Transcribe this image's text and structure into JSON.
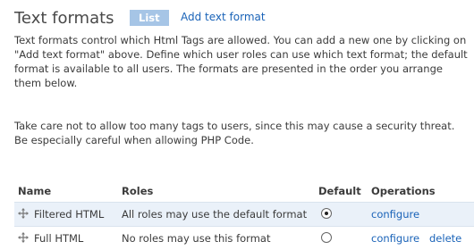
{
  "header": {
    "title": "Text formats",
    "tab_list": "List",
    "tab_add": "Add text format"
  },
  "description": {
    "p1": "Text formats control which Html Tags are allowed. You can add a new one by clicking on \"Add text format\" above. Define which user roles can use which text format; the default format is available to all users. The formats are presented in the order you arrange them below.",
    "p2": "Take care not to allow too many tags to users, since this may cause a security threat. Be especially careful when allowing PHP Code."
  },
  "table": {
    "headers": {
      "name": "Name",
      "roles": "Roles",
      "default": "Default",
      "operations": "Operations"
    },
    "rows": [
      {
        "name": "Filtered HTML",
        "roles": "All roles may use the default format",
        "default": true,
        "configure": "configure",
        "delete": ""
      },
      {
        "name": "Full HTML",
        "roles": "No roles may use this format",
        "default": false,
        "configure": "configure",
        "delete": "delete"
      }
    ]
  }
}
